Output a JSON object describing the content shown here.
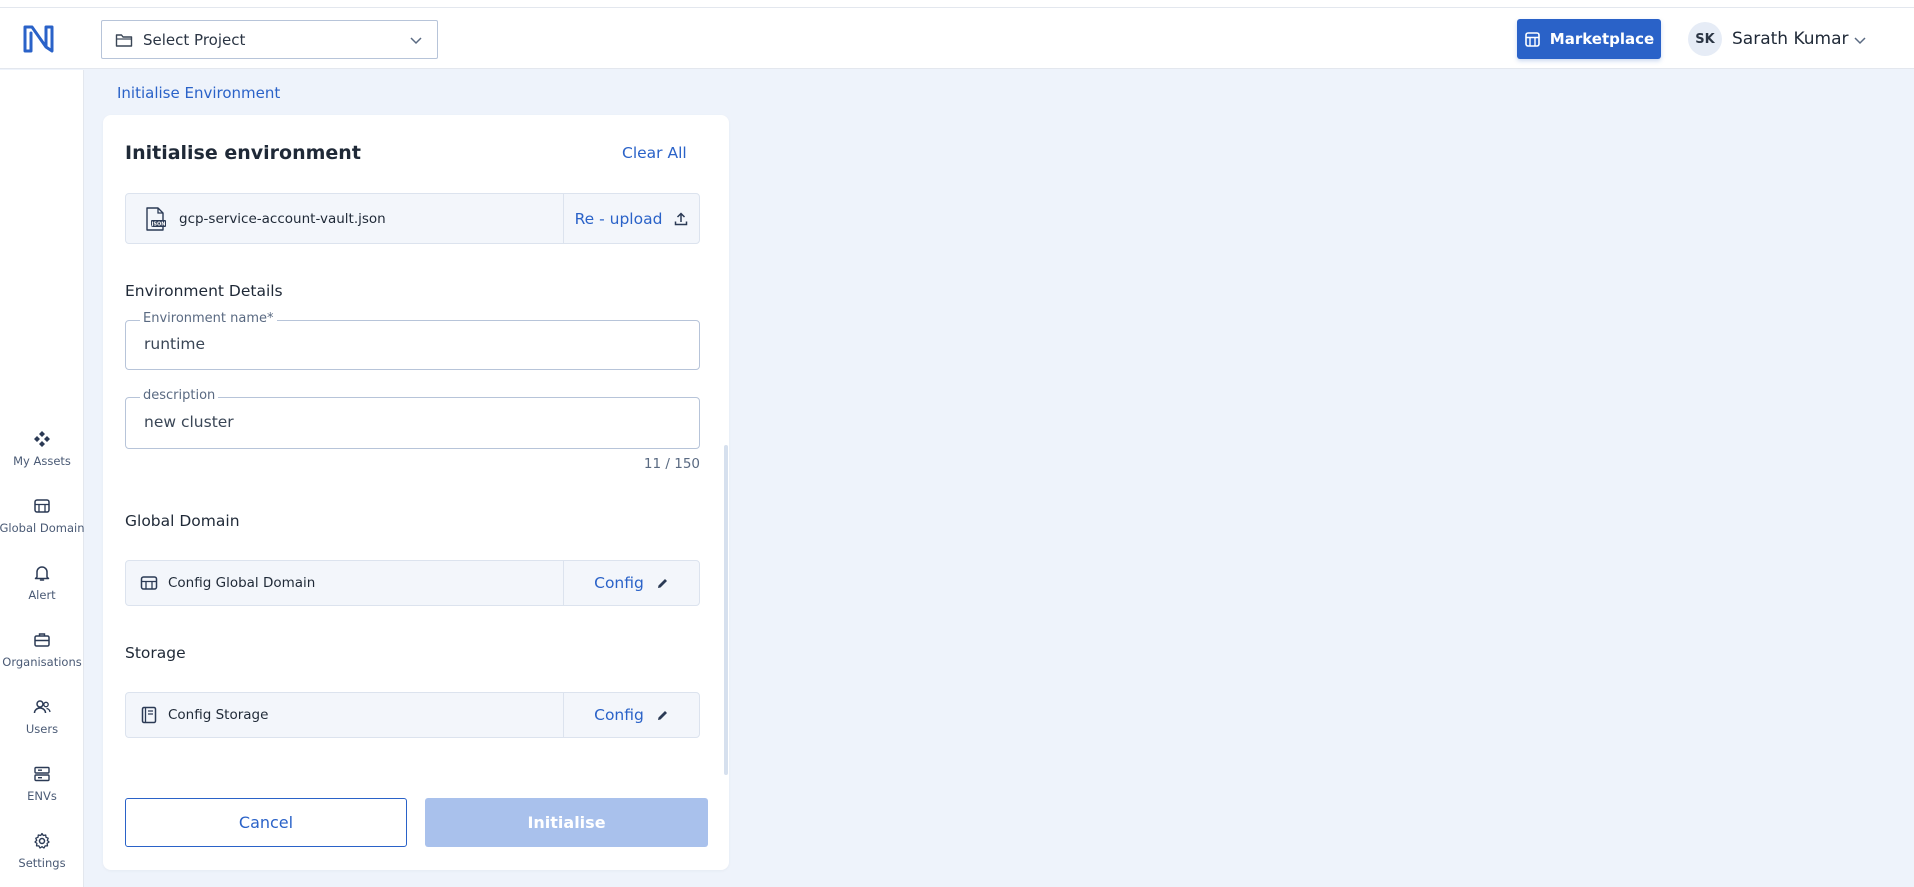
{
  "header": {
    "project_select_label": "Select Project",
    "marketplace_label": "Marketplace",
    "user_initials": "SK",
    "user_name": "Sarath Kumar"
  },
  "sidebar": {
    "items": [
      {
        "label": "My Assets",
        "icon": "diamond-cluster-icon"
      },
      {
        "label": "Global Domain",
        "icon": "storefront-icon"
      },
      {
        "label": "Alert",
        "icon": "bell-icon"
      },
      {
        "label": "Organisations",
        "icon": "briefcase-icon"
      },
      {
        "label": "Users",
        "icon": "users-icon"
      },
      {
        "label": "ENVs",
        "icon": "server-icon"
      },
      {
        "label": "Settings",
        "icon": "gear-icon"
      }
    ]
  },
  "breadcrumb": "Initialise Environment",
  "card": {
    "title": "Initialise environment",
    "clear_all": "Clear All",
    "file": {
      "name": "gcp-service-account-vault.json",
      "action": "Re - upload"
    },
    "env_section_title": "Environment Details",
    "env_name": {
      "label": "Environment name*",
      "value": "runtime"
    },
    "description": {
      "label": "description",
      "value": "new cluster",
      "counter": "11 / 150"
    },
    "global_domain": {
      "title": "Global Domain",
      "item_label": "Config Global Domain",
      "action": "Config"
    },
    "storage": {
      "title": "Storage",
      "item_label": "Config Storage",
      "action": "Config"
    },
    "cancel_label": "Cancel",
    "initialise_label": "Initialise"
  },
  "colors": {
    "primary": "#2a62c8",
    "disabled_primary": "#a9c1ec",
    "background": "#eef3fb"
  }
}
